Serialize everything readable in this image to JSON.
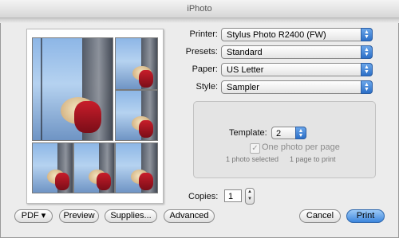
{
  "window": {
    "title": "iPhoto"
  },
  "form": {
    "printer": {
      "label": "Printer:",
      "value": "Stylus Photo R2400 (FW)"
    },
    "presets": {
      "label": "Presets:",
      "value": "Standard"
    },
    "paper": {
      "label": "Paper:",
      "value": "US Letter"
    },
    "style": {
      "label": "Style:",
      "value": "Sampler"
    }
  },
  "template_group": {
    "template_label": "Template:",
    "template_value": "2",
    "one_photo_label": "One photo per page",
    "one_photo_checked": true,
    "photos_selected": "1 photo selected",
    "pages_to_print": "1 page to print"
  },
  "copies": {
    "label": "Copies:",
    "value": "1"
  },
  "buttons": {
    "pdf": "PDF ▾",
    "preview": "Preview",
    "supplies": "Supplies...",
    "advanced": "Advanced",
    "cancel": "Cancel",
    "print": "Print"
  },
  "colors": {
    "accent": "#3d86dd",
    "window_bg": "#ececec"
  },
  "icons": {
    "popup_arrows": "updown-arrows-icon",
    "stepper": "stepper-arrows-icon",
    "checkmark": "checkmark-icon"
  }
}
